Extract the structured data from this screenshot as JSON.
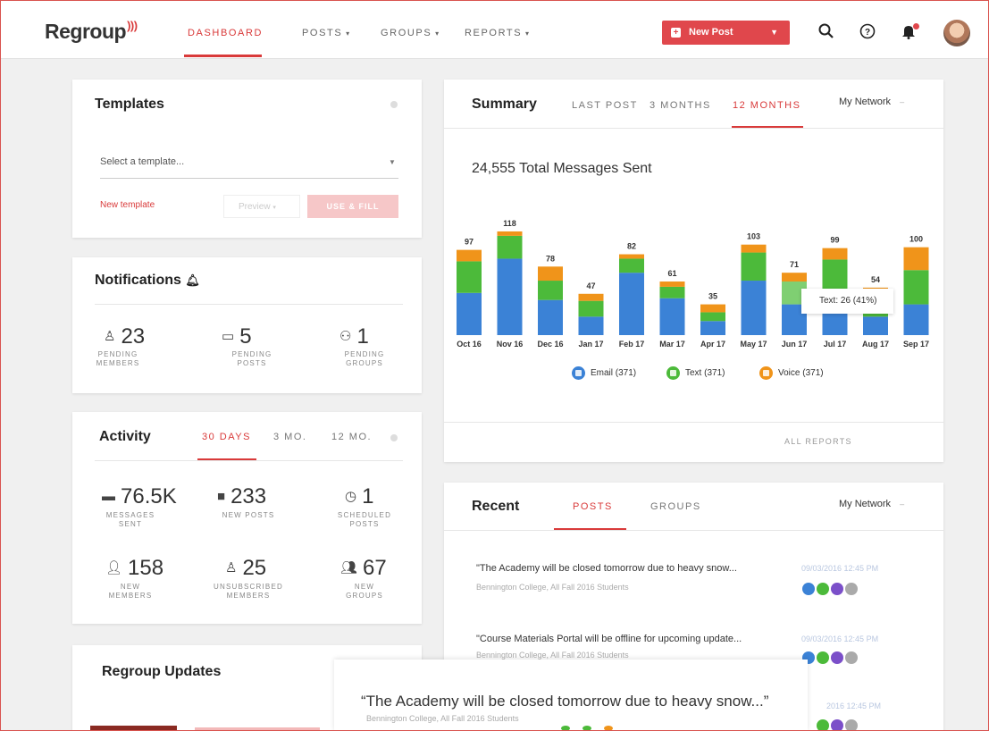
{
  "app": {
    "logo": "Regroup"
  },
  "nav": {
    "items": [
      {
        "label": "DASHBOARD"
      },
      {
        "label": "POSTS"
      },
      {
        "label": "GROUPS"
      },
      {
        "label": "REPORTS"
      }
    ],
    "new_post_label": "New Post"
  },
  "templates": {
    "title": "Templates",
    "select_placeholder": "Select a template...",
    "new_template": "New template",
    "preview": "Preview",
    "use_label": "USE & FILL"
  },
  "notifications": {
    "title": "Notifications",
    "stats": [
      {
        "value": "23",
        "label_1": "PENDING",
        "label_2": "MEMBERS"
      },
      {
        "value": "5",
        "label_1": "PENDING",
        "label_2": "POSTS"
      },
      {
        "value": "1",
        "label_1": "PENDING",
        "label_2": "GROUPS"
      }
    ]
  },
  "activity": {
    "title": "Activity",
    "tabs": [
      "30 DAYS",
      "3 MO.",
      "12 MO."
    ],
    "stats": [
      {
        "value": "76.5K",
        "label_1": "MESSAGES",
        "label_2": "SENT"
      },
      {
        "value": "233",
        "label_1": "NEW POSTS",
        "label_2": ""
      },
      {
        "value": "1",
        "label_1": "SCHEDULED",
        "label_2": "POSTS"
      },
      {
        "value": "158",
        "label_1": "NEW",
        "label_2": "MEMBERS"
      },
      {
        "value": "25",
        "label_1": "UNSUBSCRIBED",
        "label_2": "MEMBERS"
      },
      {
        "value": "67",
        "label_1": "NEW",
        "label_2": "GROUPS"
      }
    ]
  },
  "updates": {
    "title": "Regroup Updates"
  },
  "summary": {
    "title": "Summary",
    "tabs": [
      "LAST POST",
      "3 MONTHS",
      "12 MONTHS"
    ],
    "network": "My Network",
    "total": "24,555 Total Messages Sent",
    "tooltip": "Text: 26 (41%)",
    "legend": [
      "Email (371)",
      "Text (371)",
      "Voice (371)"
    ],
    "all_reports": "ALL REPORTS"
  },
  "colors": {
    "email": "#3b82d6",
    "text": "#4cba3a",
    "voice": "#f0941a",
    "accent": "#d93a3a"
  },
  "chart_data": {
    "type": "bar",
    "stacked": true,
    "categories": [
      "Oct 16",
      "Nov 16",
      "Dec 16",
      "Jan 17",
      "Feb 17",
      "Mar 17",
      "Apr 17",
      "May 17",
      "Jun 17",
      "Jul 17",
      "Aug 17",
      "Sep 17"
    ],
    "totals": [
      97,
      118,
      78,
      47,
      82,
      61,
      35,
      103,
      71,
      99,
      54,
      100
    ],
    "series": [
      {
        "name": "Email",
        "values": [
          48,
          87,
          40,
          21,
          71,
          42,
          16,
          62,
          35,
          44,
          21,
          35
        ]
      },
      {
        "name": "Text",
        "values": [
          36,
          26,
          22,
          18,
          16,
          13,
          10,
          32,
          26,
          42,
          21,
          39
        ]
      },
      {
        "name": "Voice",
        "values": [
          13,
          5,
          16,
          8,
          5,
          6,
          9,
          9,
          10,
          13,
          12,
          26
        ]
      }
    ],
    "legend": [
      "Email (371)",
      "Text (371)",
      "Voice (371)"
    ],
    "ylim": [
      0,
      120
    ]
  },
  "recent": {
    "title": "Recent",
    "tabs": [
      "POSTS",
      "GROUPS"
    ],
    "network": "My Network",
    "items": [
      {
        "text": "\"The Academy will be closed tomorrow due to heavy snow...",
        "sub": "Bennington College, All Fall 2016 Students",
        "date": "09/03/2016 12:45 PM"
      },
      {
        "text": "\"Course Materials Portal will be offline for upcoming update...",
        "sub": "Bennington College, All Fall 2016 Students",
        "date": "09/03/2016 12:45 PM"
      }
    ]
  },
  "toast": {
    "text": "“The Academy will be closed tomorrow due to heavy snow...”",
    "sub": "Bennington College, All Fall 2016 Students",
    "date": "2016 12:45 PM"
  }
}
